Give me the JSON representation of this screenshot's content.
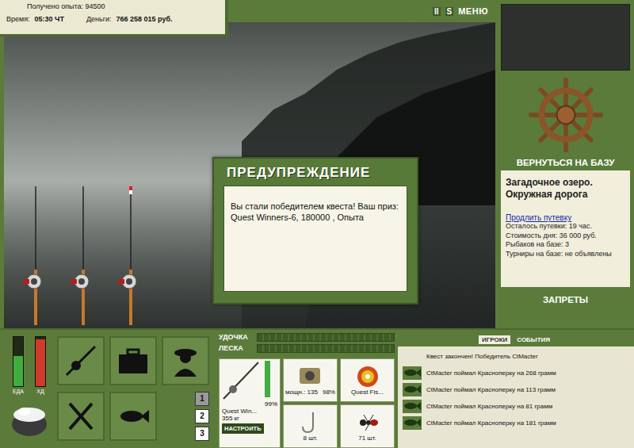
{
  "header": {
    "experience": "Получено опыта: 94500",
    "time_label": "Время:",
    "time": "05:30 ЧТ",
    "money_label": "Деньги:",
    "money": "766 258 015 руб.",
    "controls": [
      "II",
      "S",
      "МЕНЮ"
    ]
  },
  "rods": [
    {
      "float_visible": false
    },
    {
      "float_visible": false
    },
    {
      "float_visible": true
    }
  ],
  "dialog": {
    "title": "ПРЕДУПРЕЖДЕНИЕ",
    "message": "Вы стали победителем квеста! Ваш приз: Quest Winners-6, 180000 , Опыта"
  },
  "base": {
    "button": "ВЕРНУТЬСЯ НА БАЗУ",
    "location": "Загадочное озеро. Окружная дорога",
    "link": "Продлить путевку",
    "details": [
      "Осталось путевки: 19 час.",
      "Стоимость дня: 36 000 руб.",
      "Рыбаков на базе: 3",
      "Турниры на базе: не объявлены"
    ],
    "bans": "ЗАПРЕТЫ"
  },
  "meters": [
    {
      "label": "ЕДА",
      "level": 0.6,
      "color": "#3fae3f"
    },
    {
      "label": "ХД",
      "level": 0.95,
      "color": "#d03a2a"
    }
  ],
  "pages": [
    {
      "label": "1",
      "selected": true
    },
    {
      "label": "2",
      "selected": false
    },
    {
      "label": "3",
      "selected": false
    }
  ],
  "gauges": [
    {
      "label": "УДОЧКА",
      "level": 0
    },
    {
      "label": "ЛЕСКА",
      "level": 0
    }
  ],
  "tackle": {
    "rod": {
      "name": "Quest Win...",
      "load": "355 кг",
      "condition": "99%",
      "level": 0.99,
      "button": "НАСТРОИТЬ"
    },
    "reel": {
      "power": "мощн.: 135",
      "condition": "98%"
    },
    "line": {
      "name": "Quest Fis..."
    },
    "hook": {
      "count": "8 шт."
    },
    "bait": {
      "count": "71 шт."
    }
  },
  "feed": {
    "tabs": [
      {
        "label": "ИГРОКИ",
        "selected": true
      },
      {
        "label": "СОБЫТИЯ",
        "selected": false
      }
    ],
    "entries": [
      {
        "text": "Квест закончен! Победитель CtMacter",
        "kind": "notice"
      },
      {
        "text": "CtMacter поймал Красноперку на 268 грамм",
        "kind": "catch"
      },
      {
        "text": "CtMacter поймал Красноперку на 113 грамм",
        "kind": "catch"
      },
      {
        "text": "CtMacter поймал Красноперку на 81 грамм",
        "kind": "catch"
      },
      {
        "text": "CtMacter поймал Красноперку на 181 грамм",
        "kind": "catch"
      }
    ]
  }
}
